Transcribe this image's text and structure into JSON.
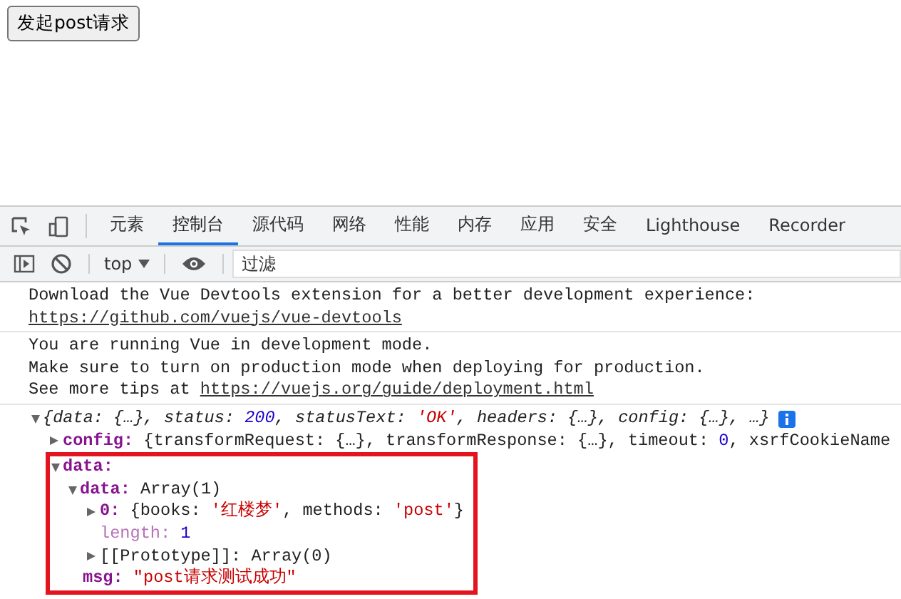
{
  "button": {
    "label": "发起post请求"
  },
  "devtools": {
    "tabs": [
      {
        "label": "元素",
        "selected": false
      },
      {
        "label": "控制台",
        "selected": true
      },
      {
        "label": "源代码",
        "selected": false
      },
      {
        "label": "网络",
        "selected": false
      },
      {
        "label": "性能",
        "selected": false
      },
      {
        "label": "内存",
        "selected": false
      },
      {
        "label": "应用",
        "selected": false
      },
      {
        "label": "安全",
        "selected": false
      },
      {
        "label": "Lighthouse",
        "selected": false
      },
      {
        "label": "Recorder",
        "selected": false
      }
    ],
    "toolbar": {
      "context": "top",
      "filter": {
        "placeholder": "过滤"
      }
    },
    "messages": [
      {
        "kind": "text",
        "lines": [
          {
            "text": "Download the Vue Devtools extension for a better development experience:"
          },
          {
            "link": "https://github.com/vuejs/vue-devtools"
          }
        ]
      },
      {
        "kind": "text",
        "lines": [
          {
            "text": "You are running Vue in development mode."
          },
          {
            "text": "Make sure to turn on production mode when deploying for production."
          },
          {
            "text": "See more tips at",
            "link": "https://vuejs.org/guide/deployment.html"
          }
        ]
      },
      {
        "kind": "object",
        "expanded": true,
        "summary": [
          {
            "text": "{data: {…}, status: ",
            "kind": "plain"
          },
          {
            "text": "200",
            "kind": "number"
          },
          {
            "text": ", statusText: ",
            "kind": "plain"
          },
          {
            "text": "'OK'",
            "kind": "string"
          },
          {
            "text": ", headers: {…}, config: {…}, …}",
            "kind": "plain"
          }
        ],
        "children": [
          {
            "key": "config:",
            "kind": "own",
            "expanded": false,
            "value": [
              {
                "text": "{transformRequest: {…}, transformResponse: {…}, timeout: ",
                "kind": "plain"
              },
              {
                "text": "0",
                "kind": "number"
              },
              {
                "text": ", xsrfCookieName",
                "kind": "plain"
              }
            ]
          },
          {
            "key": "data:",
            "kind": "own",
            "expanded": true,
            "highlighted": true,
            "children": [
              {
                "key": "data:",
                "kind": "own",
                "expanded": true,
                "value": [
                  {
                    "text": "Array(1)",
                    "kind": "plain"
                  }
                ],
                "children": [
                  {
                    "key": "0:",
                    "kind": "own",
                    "expanded": false,
                    "value": [
                      {
                        "text": "{books: ",
                        "kind": "plain"
                      },
                      {
                        "text": "'红楼梦'",
                        "kind": "string"
                      },
                      {
                        "text": ", methods: ",
                        "kind": "plain"
                      },
                      {
                        "text": "'post'",
                        "kind": "string"
                      },
                      {
                        "text": "}",
                        "kind": "plain"
                      }
                    ]
                  },
                  {
                    "key": "length:",
                    "kind": "dim",
                    "value": [
                      {
                        "text": "1",
                        "kind": "number"
                      }
                    ]
                  },
                  {
                    "key": "[[Prototype]]:",
                    "kind": "internal",
                    "expanded": false,
                    "value": [
                      {
                        "text": "Array(0)",
                        "kind": "plain"
                      }
                    ]
                  }
                ]
              },
              {
                "key": "msg:",
                "kind": "own",
                "value": [
                  {
                    "text": "\"post请求测试成功\"",
                    "kind": "string"
                  }
                ]
              }
            ]
          }
        ]
      }
    ]
  }
}
